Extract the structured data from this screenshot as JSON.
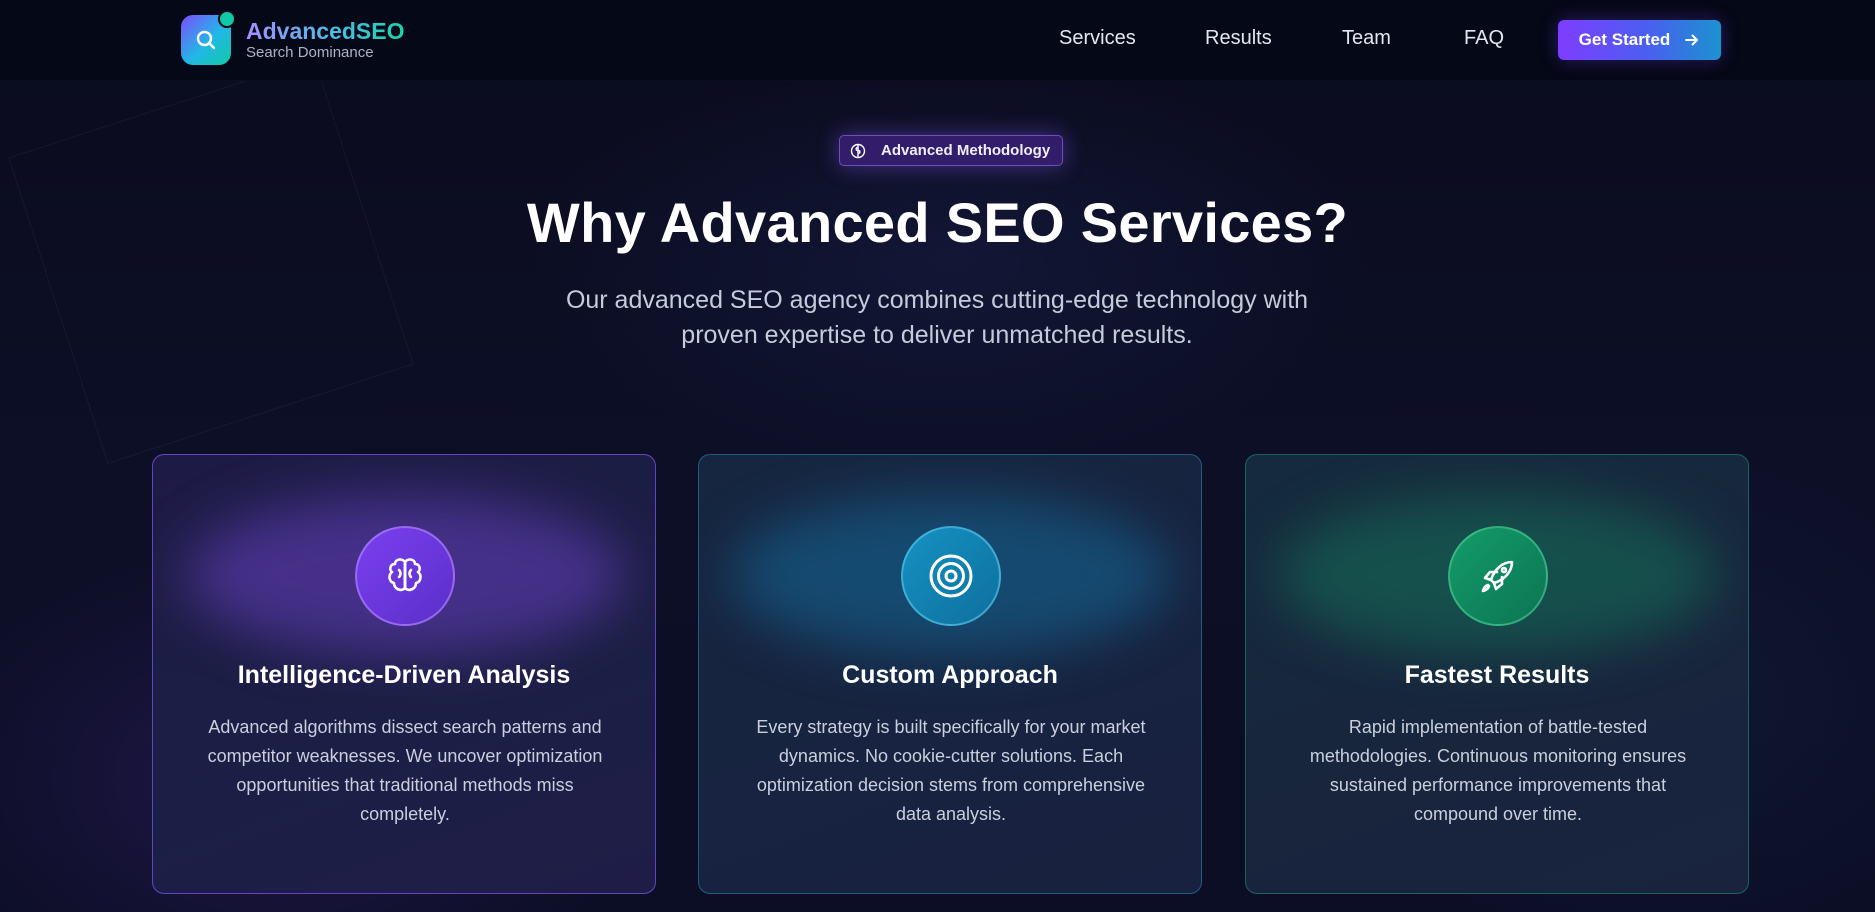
{
  "brand": {
    "name": "AdvancedSEO",
    "tagline": "Search Dominance",
    "logo_icon": "search-icon"
  },
  "nav": {
    "items": [
      {
        "label": "Services"
      },
      {
        "label": "Results"
      },
      {
        "label": "Team"
      },
      {
        "label": "FAQ"
      }
    ],
    "cta": {
      "label": "Get Started",
      "icon": "arrow-right-icon"
    }
  },
  "hero": {
    "badge": {
      "label": "Advanced Methodology",
      "icon": "brain-icon"
    },
    "title": "Why Advanced SEO Services?",
    "subtitle": "Our advanced SEO agency combines cutting-edge technology with proven expertise to deliver unmatched results."
  },
  "cards": [
    {
      "icon": "brain-icon",
      "title": "Intelligence-Driven Analysis",
      "description": "Advanced algorithms dissect search patterns and competitor weaknesses. We uncover optimization opportunities that traditional methods miss completely.",
      "accent": "#7b3ff0"
    },
    {
      "icon": "target-icon",
      "title": "Custom Approach",
      "description": "Every strategy is built specifically for your market dynamics. No cookie-cutter solutions. Each optimization decision stems from comprehensive data analysis.",
      "accent": "#1592c2"
    },
    {
      "icon": "rocket-icon",
      "title": "Fastest Results",
      "description": "Rapid implementation of battle-tested methodologies. Continuous monitoring ensures sustained performance improvements that compound over time.",
      "accent": "#139c6a"
    }
  ],
  "colors": {
    "background": "#0b0d22",
    "navbar": "#050816",
    "primary_purple": "#7f3dff",
    "primary_blue": "#1b92cf",
    "primary_teal": "#12c9a5"
  }
}
